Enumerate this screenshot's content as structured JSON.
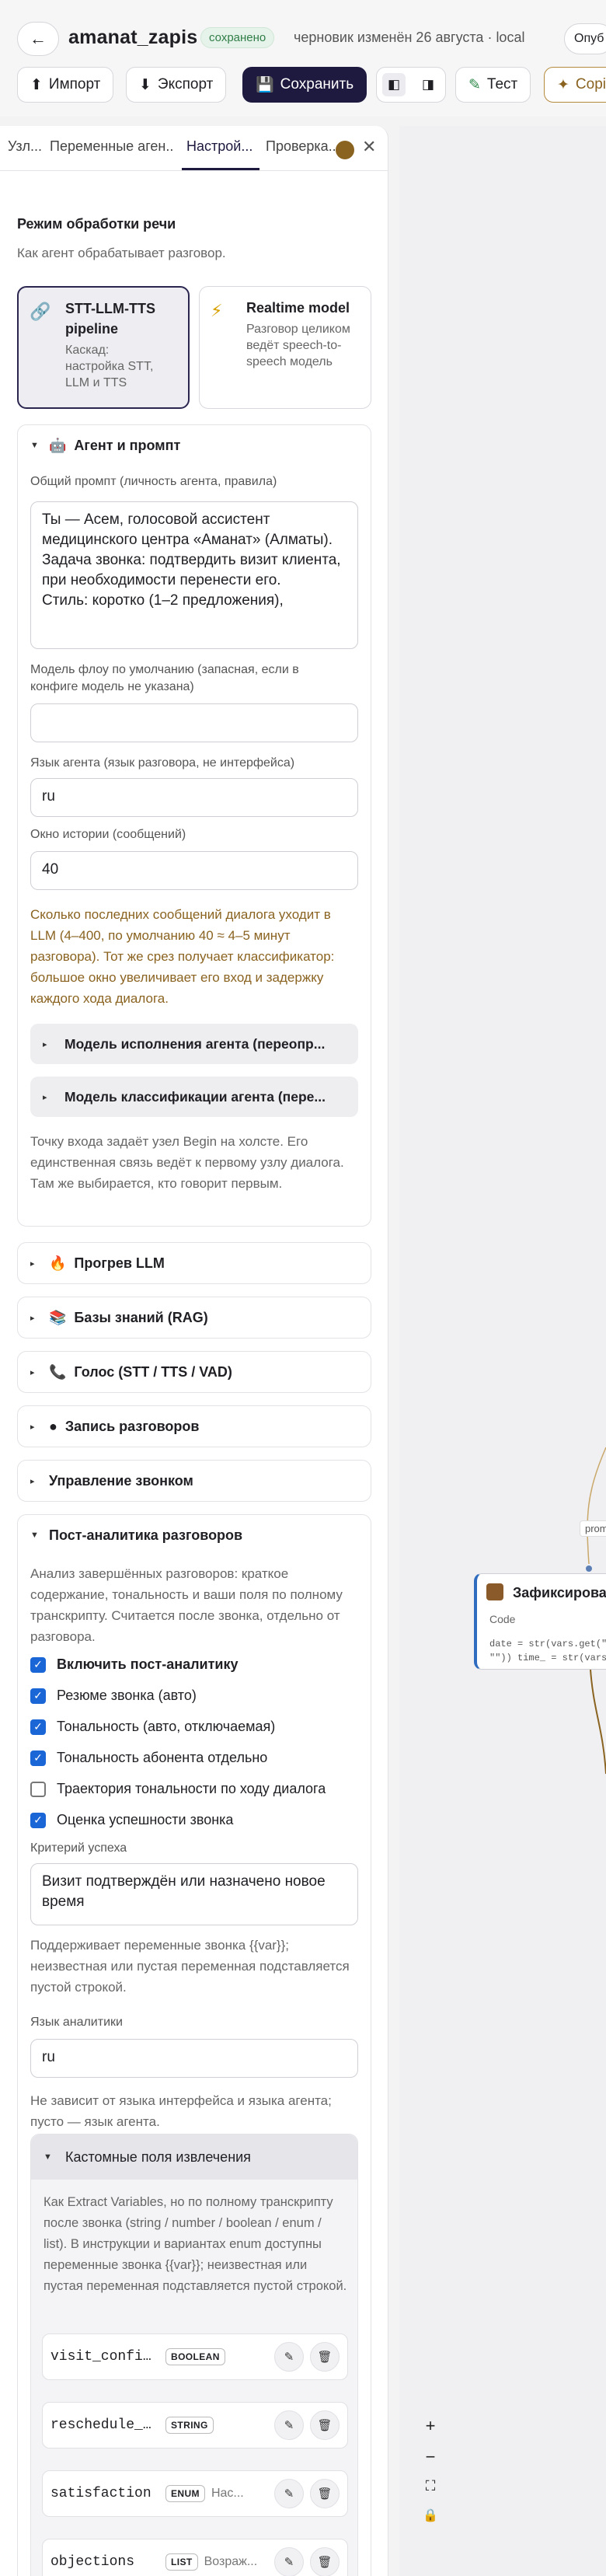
{
  "header": {
    "back_icon": "←",
    "agent_name": "amanat_zapis",
    "saved_badge": "сохранено",
    "draft_info": "черновик изменён 26 августа · local",
    "publish_label": "Опуб",
    "import_label": "Импорт",
    "export_label": "Экспорт",
    "save_label": "Сохранить",
    "test_label": "Тест",
    "copilot_label": "Copi"
  },
  "tabs": [
    {
      "label": "Узл..."
    },
    {
      "label": "Переменные аген..."
    },
    {
      "label": "Настрой..."
    },
    {
      "label": "Проверка..."
    }
  ],
  "mode": {
    "title": "Режим обработки речи",
    "subtitle": "Как агент обрабатывает разговор.",
    "option1": {
      "title": "STT-LLM-TTS pipeline",
      "desc": "Каскад: настройка STT, LLM и TTS"
    },
    "option2": {
      "title": "Realtime model",
      "desc": "Разговор целиком ведёт speech-to-speech модель"
    }
  },
  "agent": {
    "section_title": "Агент и промпт",
    "prompt_label": "Общий промпт (личность агента, правила)",
    "prompt_value": "Ты — Асем, голосовой ассистент медицинского центра «Аманат» (Алматы). Задача звонка: подтвердить визит клиента, при необходимости перенести его.\nСтиль: коротко (1–2 предложения),",
    "model_label": "Модель флоу по умолчанию (запасная, если в конфиге модель не указана)",
    "model_value": "",
    "lang_label": "Язык агента (язык разговора, не интерфейса)",
    "lang_value": "ru",
    "history_label": "Окно истории (сообщений)",
    "history_value": "40",
    "history_hint": "Сколько последних сообщений диалога уходит в LLM (4–400, по умолчанию 40 ≈ 4–5 минут разговора). Тот же срез получает классификатор: большое окно увеличивает его вход и задержку каждого хода диалога.",
    "exec_model_label": "Модель исполнения агента (переопр...",
    "class_model_label": "Модель классификации агента (пере...",
    "entry_hint": "Точку входа задаёт узел Begin на холсте. Его единственная связь ведёт к первому узлу диалога. Там же выбирается, кто говорит первым."
  },
  "sections": {
    "warmup": "Прогрев LLM",
    "kb": "Базы знаний (RAG)",
    "voice": "Голос (STT / TTS / VAD)",
    "recording": "Запись разговоров",
    "call_control": "Управление звонком"
  },
  "analytics": {
    "section_title": "Пост-аналитика разговоров",
    "intro": "Анализ завершённых разговоров: краткое содержание, тональность и ваши поля по полному транскрипту. Считается после звонка, отдельно от разговора.",
    "checks": [
      {
        "label": "Включить пост-аналитику",
        "checked": true,
        "bold": true
      },
      {
        "label": "Резюме звонка (авто)",
        "checked": true
      },
      {
        "label": "Тональность (авто, отключаемая)",
        "checked": true
      },
      {
        "label": "Тональность абонента отдельно",
        "checked": true
      },
      {
        "label": "Траектория тональности по ходу диалога",
        "checked": false
      },
      {
        "label": "Оценка успешности звонка",
        "checked": true
      }
    ],
    "criteria_label": "Критерий успеха",
    "criteria_value": "Визит подтверждён или назначено новое время",
    "criteria_hint": "Поддерживает переменные звонка {{var}}; неизвестная или пустая переменная подставляется пустой строкой.",
    "lang_label": "Язык аналитики",
    "lang_value": "ru",
    "lang_hint": "Не зависит от языка интерфейса и языка агента; пусто — язык агента.",
    "custom_title": "Кастомные поля извлечения",
    "custom_hint": "Как Extract Variables, но по полному транскрипту после звонка (string / number / boolean / enum / list). В инструкции и вариантах enum доступны переменные звонка {{var}}; неизвестная или пустая переменная подставляется пустой строкой.",
    "fields": [
      {
        "name": "visit_confir...",
        "type": "BOOLEAN",
        "desc": ""
      },
      {
        "name": "reschedule_rea...",
        "type": "STRING",
        "desc": ""
      },
      {
        "name": "satisfaction",
        "type": "ENUM",
        "desc": "Нас..."
      },
      {
        "name": "objections",
        "type": "LIST",
        "desc": "Возраж..."
      }
    ]
  },
  "canvas": {
    "node_title": "Зафиксирова",
    "node_type": "Code",
    "node_code_1": "date = str(vars.get(\"app",
    "node_code_2": "\"\")) time_ = str(vars.get(",
    "edge_label": "promp",
    "zoom_in": "+",
    "zoom_out": "−",
    "fit": "⛶",
    "lock": "🔒"
  }
}
